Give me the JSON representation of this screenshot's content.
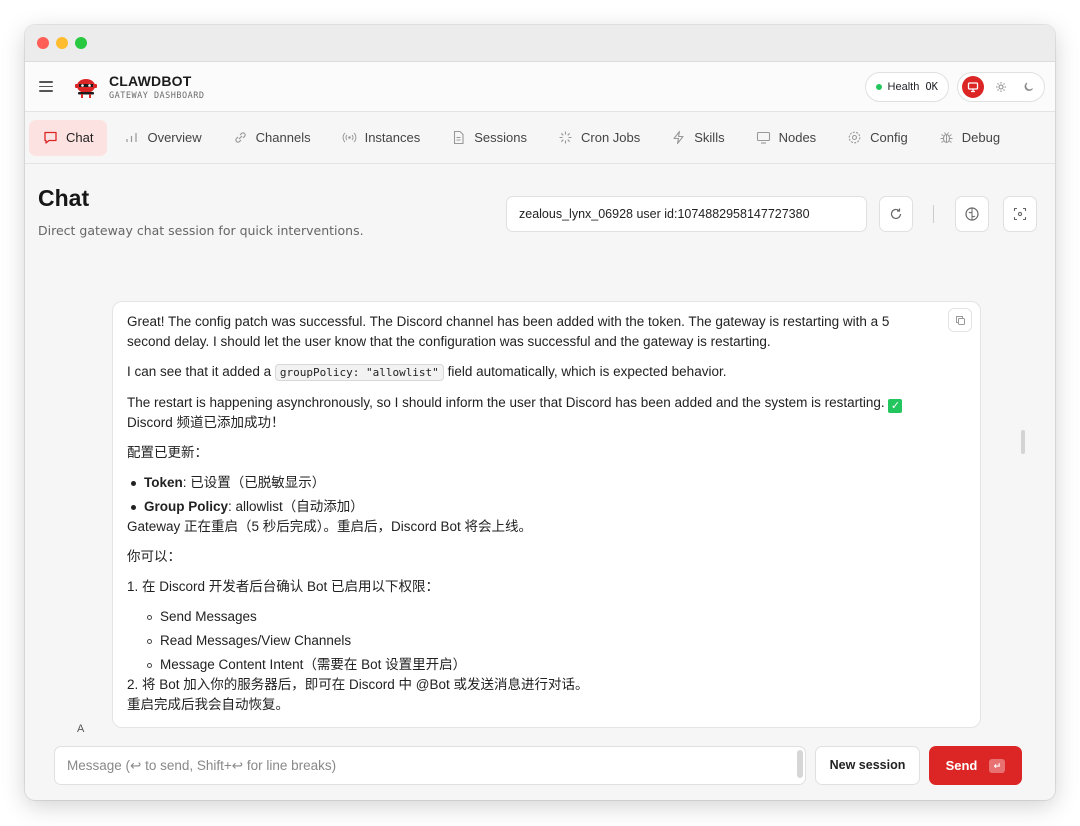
{
  "app": {
    "brand_title": "CLAWDBOT",
    "brand_subtitle": "GATEWAY DASHBOARD",
    "health_label": "Health",
    "health_value": "OK",
    "colors": {
      "accent": "#dc2626",
      "health": "#22c55e",
      "active_tab_bg": "#fde2e2"
    }
  },
  "tabs": [
    {
      "label": "Chat",
      "icon": "message-icon"
    },
    {
      "label": "Overview",
      "icon": "bar-chart-icon"
    },
    {
      "label": "Channels",
      "icon": "link-icon"
    },
    {
      "label": "Instances",
      "icon": "radio-icon"
    },
    {
      "label": "Sessions",
      "icon": "file-icon"
    },
    {
      "label": "Cron Jobs",
      "icon": "loader-icon"
    },
    {
      "label": "Skills",
      "icon": "zap-icon"
    },
    {
      "label": "Nodes",
      "icon": "monitor-icon"
    },
    {
      "label": "Config",
      "icon": "gear-icon"
    },
    {
      "label": "Debug",
      "icon": "bug-icon"
    }
  ],
  "page": {
    "title": "Chat",
    "subtitle": "Direct gateway chat session for quick interventions.",
    "session_value": "zealous_lynx_06928 user id:1074882958147727380"
  },
  "message": {
    "p1": "Great! The config patch was successful. The Discord channel has been added with the token. The gateway is restarting with a 5 second delay. I should let the user know that the configuration was successful and the gateway is restarting.",
    "p2_before": "I can see that it added a ",
    "p2_code": "groupPolicy: \"allowlist\"",
    "p2_after": " field automatically, which is expected behavior.",
    "p3": "The restart is happening asynchronously, so I should inform the user that Discord has been added and the system is restarting.",
    "p3_line2": "Discord 频道已添加成功！",
    "config_updated": "配置已更新：",
    "bullet1_key": "Token",
    "bullet1_val": ": 已设置（已脱敏显示）",
    "bullet2_key": "Group Policy",
    "bullet2_val": ": allowlist（自动添加）",
    "gateway_line": "Gateway 正在重启（5 秒后完成）。重启后，Discord Bot 将会上线。",
    "you_can": "你可以：",
    "step1": "1. 在 Discord 开发者后台确认 Bot 已启用以下权限：",
    "perm1": "Send Messages",
    "perm2": "Read Messages/View Channels",
    "perm3": "Message Content Intent（需要在 Bot 设置里开启）",
    "step2": "2. 将 Bot 加入你的服务器后，即可在 Discord 中 @Bot 或发送消息进行对话。",
    "auto_resume": "重启完成后我会自动恢复。",
    "avatar_letter": "A"
  },
  "composer": {
    "placeholder": "Message (↩ to send, Shift+↩ for line breaks)",
    "new_session": "New session",
    "send": "Send"
  }
}
